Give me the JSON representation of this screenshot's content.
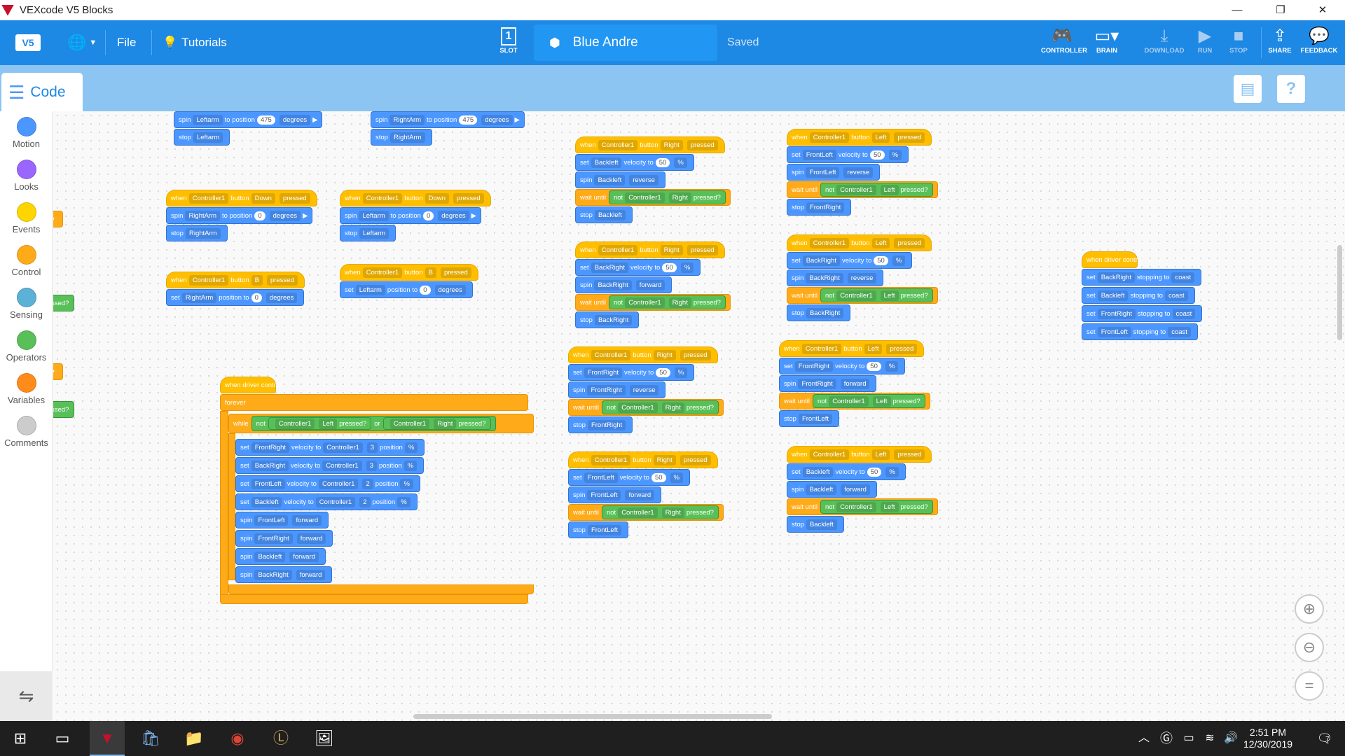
{
  "window": {
    "title": "VEXcode V5 Blocks",
    "minimize": "—",
    "restore": "❐",
    "close": "✕"
  },
  "topbar": {
    "file": "File",
    "tutorials": "Tutorials",
    "slot": {
      "number": "1",
      "label": "SLOT"
    },
    "project_name": "Blue Andre",
    "status": "Saved",
    "buttons": [
      {
        "label": "CONTROLLER",
        "icon": "controller-icon"
      },
      {
        "label": "BRAIN",
        "icon": "brain-icon"
      },
      {
        "label": "DOWNLOAD",
        "icon": "download-icon"
      },
      {
        "label": "RUN",
        "icon": "play-icon"
      },
      {
        "label": "STOP",
        "icon": "stop-icon"
      },
      {
        "label": "SHARE",
        "icon": "share-icon"
      },
      {
        "label": "FEEDBACK",
        "icon": "feedback-icon"
      }
    ]
  },
  "tab": {
    "code": "Code"
  },
  "categories": [
    {
      "label": "Motion",
      "color": "#4c97ff"
    },
    {
      "label": "Looks",
      "color": "#9966ff"
    },
    {
      "label": "Events",
      "color": "#ffd500"
    },
    {
      "label": "Control",
      "color": "#ffab19"
    },
    {
      "label": "Sensing",
      "color": "#5cb1d6"
    },
    {
      "label": "Operators",
      "color": "#59c059"
    },
    {
      "label": "Variables",
      "color": "#ff8c1a"
    },
    {
      "label": "Comments",
      "color": "#cccccc"
    }
  ],
  "blocks": {
    "b1": "spin",
    "b1a": "Leftarm",
    "b1b": "to position",
    "b1c": "475",
    "b1d": "degrees",
    "b2": "stop",
    "b2a": "Leftarm",
    "b3": "spin",
    "b3a": "RightArm",
    "b3b": "to position",
    "b3c": "475",
    "b3d": "degrees",
    "b4": "stop",
    "b4a": "RightArm",
    "when": "when",
    "controller1": "Controller1",
    "button": "button",
    "pressed": "pressed",
    "down": "Down",
    "b": "B",
    "right": "Right",
    "left": "Left",
    "spin": "spin",
    "stop": "stop",
    "set": "set",
    "to_position": "to position",
    "position_to": "position to",
    "degrees": "degrees",
    "zero": "0",
    "rightarm": "RightArm",
    "leftarm": "Leftarm",
    "velocity_to": "velocity to",
    "fifty": "50",
    "percent": "%",
    "backleft": "Backleft",
    "backright": "BackRight",
    "frontleft": "FrontLeft",
    "frontright": "FrontRight",
    "reverse": "reverse",
    "forward": "forward",
    "wait_until": "wait until",
    "not": "not",
    "pressed_q": "pressed?",
    "when_driver": "when driver control",
    "forever": "forever",
    "while": "while",
    "or": "or",
    "three": "3",
    "two": "2",
    "position": "position",
    "stopping_to": "stopping to",
    "coast": "coast",
    "partial_pressed": "ssed?"
  },
  "zoom": {
    "in": "⊕",
    "out": "⊖",
    "reset": "="
  },
  "clock": {
    "time": "2:51 PM",
    "date": "12/30/2019"
  },
  "notifications": "7"
}
